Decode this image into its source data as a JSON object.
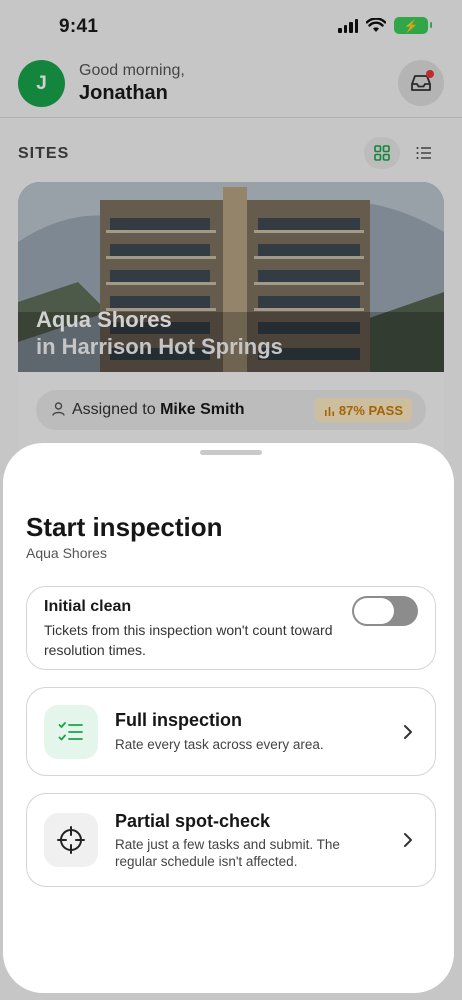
{
  "status_bar": {
    "time": "9:41"
  },
  "header": {
    "avatar_initial": "J",
    "greeting": "Good morning,",
    "username": "Jonathan"
  },
  "sites": {
    "label": "SITES",
    "card": {
      "title": "Aqua Shores",
      "subtitle": "in Harrison Hot Springs",
      "assigned_prefix": "Assigned to ",
      "assigned_name": "Mike Smith",
      "pass_rate": "87% PASS"
    }
  },
  "sheet": {
    "title": "Start inspection",
    "subtitle": "Aqua Shores",
    "initial_clean": {
      "title": "Initial clean",
      "description": "Tickets from this inspection won't count toward resolution times.",
      "enabled": false
    },
    "options": [
      {
        "title": "Full inspection",
        "description": "Rate every task across every area."
      },
      {
        "title": "Partial spot-check",
        "description": "Rate just a few tasks and submit. The regular schedule isn't affected."
      }
    ]
  },
  "colors": {
    "brand_green": "#19a34a",
    "pass_badge_bg": "#fbe8c3",
    "pass_badge_text": "#c77a05"
  }
}
